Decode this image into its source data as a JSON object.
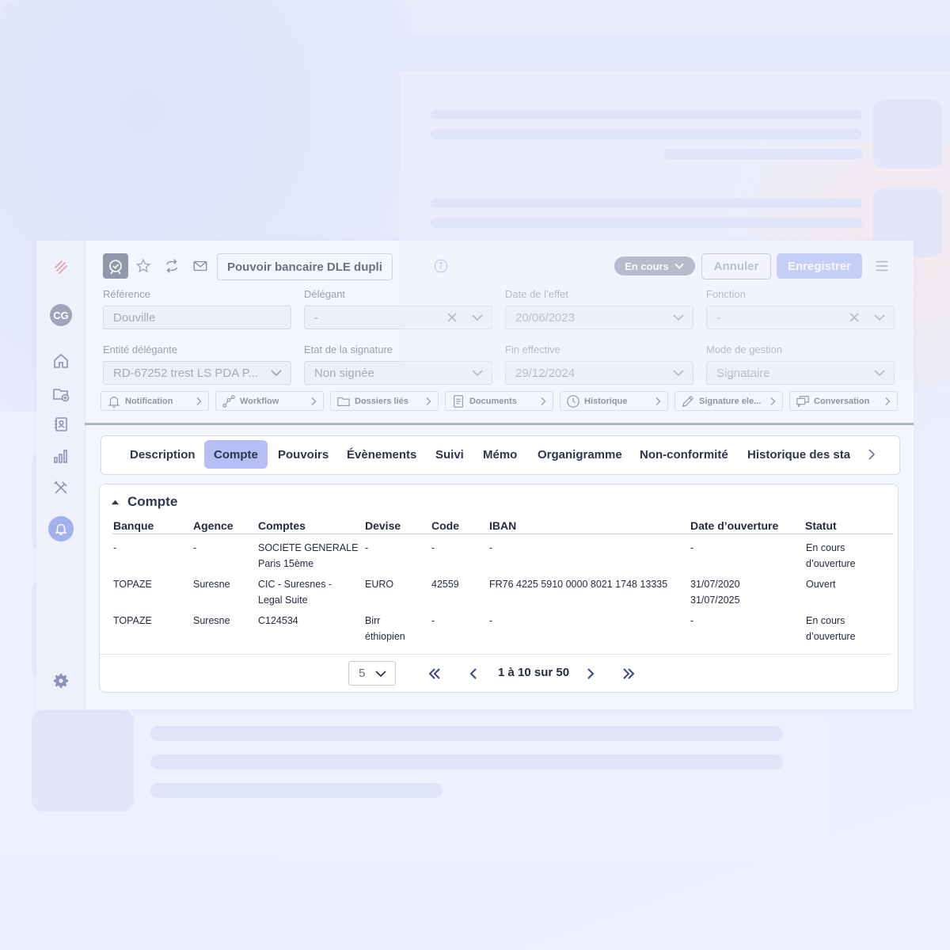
{
  "header": {
    "title": "Pouvoir bancaire DLE dupli",
    "status": "En cours",
    "cancel_label": "Annuler",
    "save_label": "Enregistrer"
  },
  "sidebar": {
    "avatar_initials": "CG",
    "items": [
      "home-icon",
      "folder-add-icon",
      "contacts-icon",
      "chart-icon",
      "tools-icon",
      "bell-icon",
      "settings-icon"
    ]
  },
  "form": {
    "fields": [
      {
        "label": "Référence",
        "value": "Douville"
      },
      {
        "label": "Délégant",
        "value": "-"
      },
      {
        "label": "Date de l’effet",
        "value": "20/06/2023"
      },
      {
        "label": "Fonction",
        "value": "-"
      },
      {
        "label": "Entité délégante",
        "value": "RD-67252 trest LS PDA P..."
      },
      {
        "label": "Etat de la signature",
        "value": "Non signée"
      },
      {
        "label": "Fin effective",
        "value": "29/12/2024"
      },
      {
        "label": "Mode de gestion",
        "value": "Signataire"
      }
    ]
  },
  "shortcuts": [
    {
      "label": "Notification",
      "icon": "bell-icon"
    },
    {
      "label": "Workflow",
      "icon": "workflow-icon"
    },
    {
      "label": "Dossiers liés",
      "icon": "folder-icon"
    },
    {
      "label": "Documents",
      "icon": "document-icon"
    },
    {
      "label": "Historique",
      "icon": "clock-icon"
    },
    {
      "label": "Signature ele...",
      "icon": "pen-icon"
    },
    {
      "label": "Conversation",
      "icon": "chat-icon"
    }
  ],
  "tabs": [
    {
      "label": "Description"
    },
    {
      "label": "Compte",
      "active": true
    },
    {
      "label": "Pouvoirs"
    },
    {
      "label": "Évènements"
    },
    {
      "label": "Suivi"
    },
    {
      "label": "Mémo"
    },
    {
      "label": "Organigramme"
    },
    {
      "label": "Non-conformité"
    },
    {
      "label": "Historique des stat"
    }
  ],
  "panel": {
    "title": "Compte",
    "columns": [
      "Banque",
      "Agence",
      "Comptes",
      "Devise",
      "Code",
      "IBAN",
      "Date d’ouverture",
      "Statut"
    ],
    "rows": [
      [
        "-",
        "-",
        "SOCIETE GENERALE\nParis 15ème",
        "-",
        "-",
        "-",
        "-",
        "En cours\nd’ouverture"
      ],
      [
        "TOPAZE",
        "Suresne",
        "CIC - Suresnes -\nLegal Suite",
        "EURO",
        "42559",
        "FR76 4225 5910 0000 8021 1748 13335",
        "31/07/2020\n31/07/2025",
        "Ouvert"
      ],
      [
        "TOPAZE",
        "Suresne",
        "C124534",
        "Birr\néthiopien",
        "-",
        "-",
        "-",
        "En cours\nd’ouverture"
      ]
    ]
  },
  "pagination": {
    "page_size": "5",
    "range_text": "1 à 10 sur 50"
  },
  "colors": {
    "accent": "#b3bcf3",
    "active_tab": "#b5bff4",
    "status_pill": "#9ba1b2"
  }
}
